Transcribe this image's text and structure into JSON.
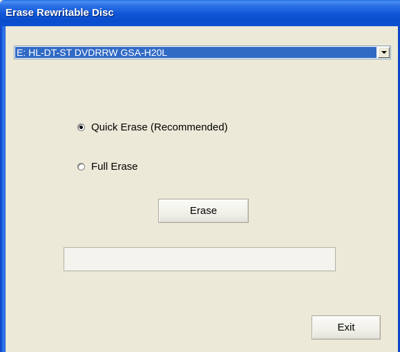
{
  "window": {
    "title": "Erase Rewritable Disc"
  },
  "drive_select": {
    "value": "E: HL-DT-ST DVDRRW GSA-H20L"
  },
  "options": {
    "quick_erase": {
      "label": "Quick Erase (Recommended)",
      "checked": true
    },
    "full_erase": {
      "label": "Full Erase",
      "checked": false
    }
  },
  "buttons": {
    "erase_label": "Erase",
    "exit_label": "Exit"
  },
  "progress": {
    "value_percent": 0
  },
  "colors": {
    "titlebar": "#0a4dcc",
    "selection": "#316ac5",
    "face": "#ece9d8"
  }
}
